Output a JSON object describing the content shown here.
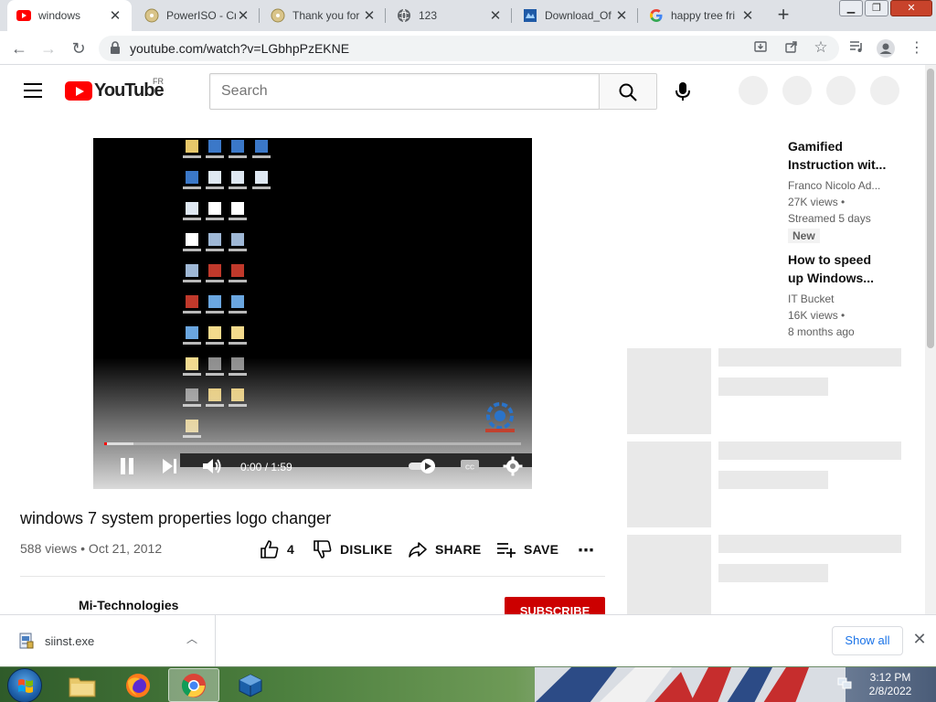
{
  "browser": {
    "tabs": [
      {
        "title": "windows",
        "active": true
      },
      {
        "title": "PowerISO - Cr",
        "active": false
      },
      {
        "title": "Thank you for",
        "active": false
      },
      {
        "title": "123",
        "active": false
      },
      {
        "title": "Download_Of",
        "active": false
      },
      {
        "title": "happy tree fri",
        "active": false
      }
    ],
    "new_tab": "+",
    "url": "youtube.com/watch?v=LGbhpPzEKNE"
  },
  "youtube": {
    "logo_text": "YouTube",
    "country": "FR",
    "search_placeholder": "Search"
  },
  "player": {
    "time": "0:00 / 1:59",
    "progress_played": 0.007,
    "progress_buffered": 0.07
  },
  "video": {
    "title": "windows 7 system properties logo changer",
    "views_date": "588 views • Oct 21, 2012",
    "likes": "4",
    "dislike_label": "DISLIKE",
    "share_label": "SHARE",
    "save_label": "SAVE",
    "channel": "Mi-Technologies",
    "subscribe_label": "SUBSCRIBE"
  },
  "related": [
    {
      "title_line1": "Gamified",
      "title_line2": "Instruction wit...",
      "channel": "Franco Nicolo Ad...",
      "views": "27K views •",
      "age": "Streamed 5 days",
      "badge": "New"
    },
    {
      "title_line1": "How to speed",
      "title_line2": "up Windows...",
      "channel": "IT Bucket",
      "views": "16K views •",
      "age": "8 months ago"
    }
  ],
  "download": {
    "filename": "siinst.exe",
    "show_all": "Show all"
  },
  "taskbar": {
    "time": "3:12 PM",
    "date": "2/8/2022"
  },
  "colors": {
    "yt_red": "#ff0000",
    "subscribe_red": "#cc0000",
    "link_blue": "#1a73e8"
  }
}
